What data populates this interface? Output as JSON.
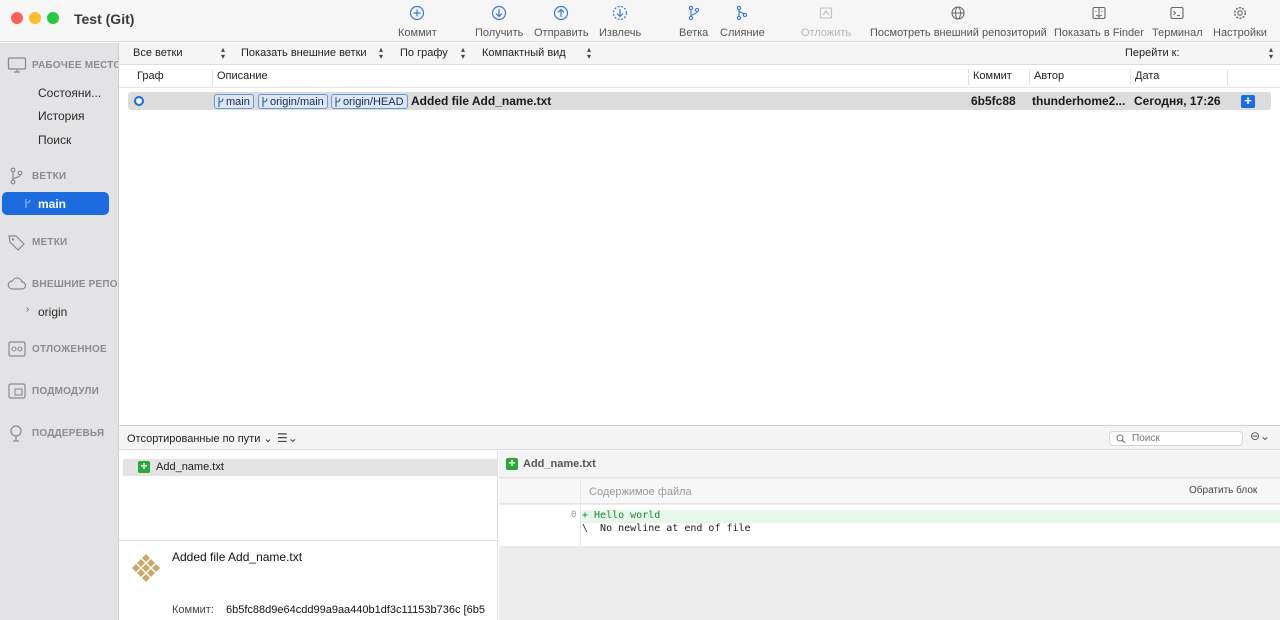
{
  "window": {
    "title": "Test (Git)"
  },
  "toolbar": {
    "commit": "Коммит",
    "pull": "Получить",
    "push": "Отправить",
    "fetch": "Извлечь",
    "branch": "Ветка",
    "merge": "Слияние",
    "stash": "Отложить",
    "view_remote": "Посмотреть внешний репозиторий",
    "show_finder": "Показать в Finder",
    "terminal": "Терминал",
    "settings": "Настройки"
  },
  "sidebar": {
    "workspace": {
      "header": "РАБОЧЕЕ МЕСТО",
      "items": [
        "Состояни...",
        "История",
        "Поиск"
      ]
    },
    "branches": {
      "header": "ВЕТКИ",
      "items": [
        "main"
      ]
    },
    "tags": {
      "header": "МЕТКИ"
    },
    "remotes": {
      "header": "ВНЕШНИЕ РЕПОЗ",
      "items": [
        "origin"
      ]
    },
    "stashes": {
      "header": "ОТЛОЖЕННОЕ"
    },
    "submodules": {
      "header": "ПОДМОДУЛИ"
    },
    "subtrees": {
      "header": "ПОДДЕРЕВЬЯ"
    }
  },
  "filters": {
    "branches": "Все ветки",
    "remote": "Показать внешние ветки",
    "order": "По графу",
    "view": "Компактный вид",
    "goto": "Перейти к:"
  },
  "columns": {
    "graph": "Граф",
    "description": "Описание",
    "commit": "Коммит",
    "author": "Автор",
    "date": "Дата"
  },
  "commits": [
    {
      "refs": [
        "main",
        "origin/main",
        "origin/HEAD"
      ],
      "message": "Added file Add_name.txt",
      "hash": "6b5fc88",
      "author": "thunderhome2...",
      "date": "Сегодня, 17:26"
    }
  ],
  "files_panel": {
    "sort_label": "Отсортированные по пути",
    "files": [
      "Add_name.txt"
    ]
  },
  "search": {
    "placeholder": "Поиск"
  },
  "details": {
    "message": "Added file Add_name.txt",
    "commit_label": "Коммит:",
    "commit_hash": "6b5fc88d9e64cdd99a9aa440b1df3c11153b736c [6b5"
  },
  "diff": {
    "file": "Add_name.txt",
    "hunk_title": "Содержимое файла",
    "revert_button": "Обратить блок",
    "line_no": "0",
    "lines": [
      "+ Hello world",
      "\\  No newline at end of file"
    ]
  },
  "colors": {
    "accent": "#1c6ce0",
    "added": "#2aa63a",
    "sidebar_bg": "#e3e3e5"
  }
}
